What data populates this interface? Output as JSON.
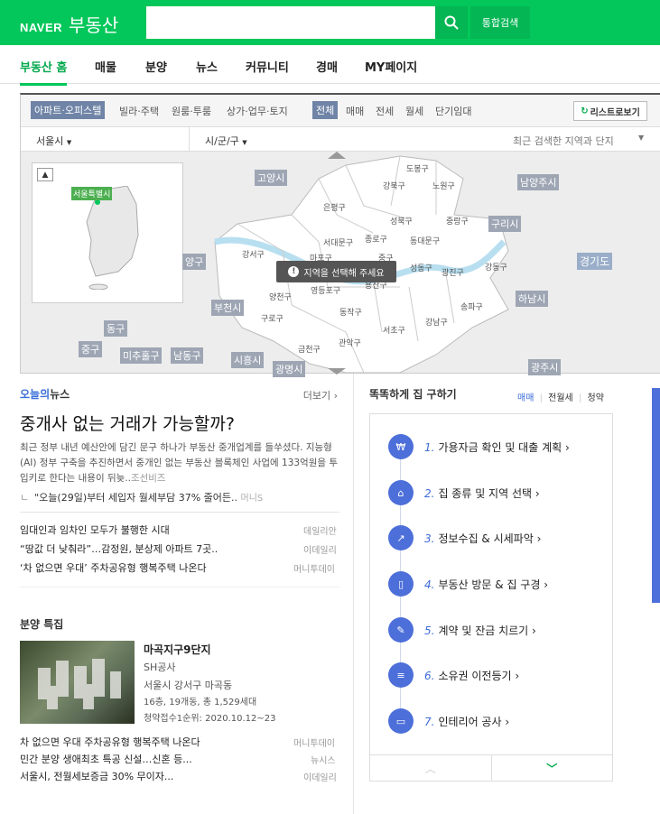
{
  "header": {
    "brand": "NAVER",
    "service": "부동산",
    "search_button": "통합검색",
    "search_value": ""
  },
  "gnb": [
    "부동산 홈",
    "매물",
    "분양",
    "뉴스",
    "커뮤니티",
    "경매",
    "MY페이지"
  ],
  "map": {
    "property_tabs": [
      "아파트·오피스텔",
      "빌라·주택",
      "원룸·투룸",
      "상가·업무·토지"
    ],
    "deal_tabs": [
      "전체",
      "매매",
      "전세",
      "월세",
      "단기임대"
    ],
    "list_view": "리스트로보기",
    "sido": "서울시",
    "sigungu": "시/군/구",
    "recent_search": "최근 검색한 지역과 단지",
    "mini_map_label": "서울특별시",
    "notice": "지역을 선택해 주세요",
    "outer_labels": [
      "고양시",
      "남양주시",
      "구리시",
      "경기도",
      "하남시",
      "부천시",
      "동구",
      "중구",
      "미추홀구",
      "남동구",
      "시흥시",
      "광명시",
      "광주시",
      "양구"
    ],
    "districts": [
      "도봉구",
      "강북구",
      "노원구",
      "은평구",
      "성북구",
      "중랑구",
      "서대문구",
      "종로구",
      "동대문구",
      "강서구",
      "마포구",
      "중구",
      "성동구",
      "광진구",
      "강동구",
      "양천구",
      "영등포구",
      "용산구",
      "구로구",
      "동작구",
      "송파구",
      "서초구",
      "강남구",
      "금천구",
      "관악구"
    ]
  },
  "news": {
    "brand": "오늘의",
    "title": "뉴스",
    "more": "더보기",
    "headline": "중개사 없는 거래가 가능할까?",
    "summary": "최근 정부 내년 예산안에 담긴 문구 하나가 부동산 중개업계를 들쑤셨다. 지능형(AI) 정부 구축을 추진하면서 중개인 없는 부동산 블록체인 사업에 133억원을 투입키로 한다는 내용이 뒤늦..",
    "summary_source": "조선비즈",
    "related": "\"오늘(29일)부터 세입자 월세부담 37% 줄어든..",
    "related_source": "머니S",
    "items": [
      {
        "title": "임대인과 임차인 모두가 불행한 시대",
        "source": "데일리안"
      },
      {
        "title": "“땅값 더 낮춰라”…감정원, 분상제 아파트 7곳..",
        "source": "이데일리"
      },
      {
        "title": "‘차 없으면 우대’ 주차공유형 행복주택 나온다",
        "source": "머니투데이"
      }
    ]
  },
  "presale": {
    "title": "분양 특집",
    "name": "마곡지구9단지",
    "company": "SH공사",
    "address": "서울시 강서구 마곡동",
    "spec": "16층, 19개동, 총 1,529세대",
    "date": "청약접수1순위: 2020.10.12~23",
    "items": [
      {
        "title": "차 없으면 우대 주차공유형 행복주택 나온다",
        "source": "머니투데이"
      },
      {
        "title": "민간 분양 생애최초 특공 신설…신혼 등...",
        "source": "뉴시스"
      },
      {
        "title": "서울시, 전월세보증금 30% 무이자...",
        "source": "이데일리"
      }
    ]
  },
  "guide": {
    "title": "똑똑하게 집 구하기",
    "tabs": [
      "매매",
      "전월세",
      "청약"
    ],
    "steps": [
      {
        "num": "1.",
        "label": "가용자금 확인 및 대출 계획"
      },
      {
        "num": "2.",
        "label": "집 종류 및 지역 선택"
      },
      {
        "num": "3.",
        "label": "정보수집 & 시세파악"
      },
      {
        "num": "4.",
        "label": "부동산 방문 & 집 구경"
      },
      {
        "num": "5.",
        "label": "계약 및 잔금 치르기"
      },
      {
        "num": "6.",
        "label": "소유권 이전등기"
      },
      {
        "num": "7.",
        "label": "인테리어 공사"
      }
    ]
  }
}
